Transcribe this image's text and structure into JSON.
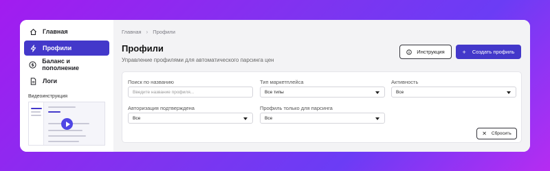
{
  "sidebar": {
    "items": [
      {
        "label": "Главная",
        "icon": "home-icon",
        "active": false
      },
      {
        "label": "Профили",
        "icon": "bolt-icon",
        "active": true
      },
      {
        "label": "Баланс и пополнение",
        "icon": "dollar-icon",
        "active": false
      },
      {
        "label": "Логи",
        "icon": "file-icon",
        "active": false
      }
    ],
    "video_title": "Видеоинструкция"
  },
  "breadcrumb": {
    "home": "Главная",
    "current": "Профили"
  },
  "header": {
    "title": "Профили",
    "subtitle": "Управление профилями для автоматического парсинга цен",
    "instruction_label": "Инструкция",
    "create_label": "Создать профиль"
  },
  "filters": {
    "search_label": "Поиск по названию",
    "search_placeholder": "Введите название профиля...",
    "marketplace_label": "Тип маркетплейса",
    "marketplace_value": "Все типы",
    "activity_label": "Активность",
    "activity_value": "Все",
    "auth_label": "Авторизация подтверждена",
    "auth_value": "Все",
    "parsing_label": "Профиль только для парсинга",
    "parsing_value": "Все",
    "reset_label": "Сбросить"
  },
  "colors": {
    "accent": "#4338ca",
    "background_gradient_start": "#a21cf0",
    "background_gradient_end": "#6b3cf5"
  }
}
